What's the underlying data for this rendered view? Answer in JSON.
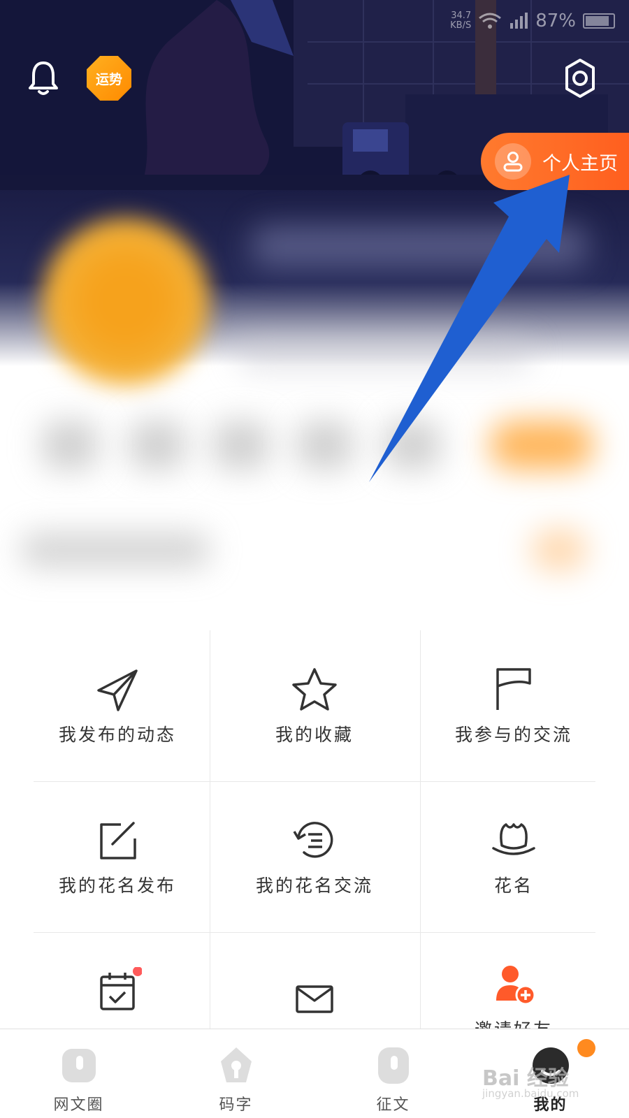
{
  "status_bar": {
    "net_speed_value": "34.7",
    "net_speed_unit": "KB/S",
    "battery_percent": "87%",
    "battery_level": 0.87
  },
  "header": {
    "fortune_badge": "运势",
    "homepage_button": "个人主页"
  },
  "menu": [
    {
      "label": "我发布的动态",
      "icon": "paper-plane-icon"
    },
    {
      "label": "我的收藏",
      "icon": "star-icon"
    },
    {
      "label": "我参与的交流",
      "icon": "flag-icon"
    },
    {
      "label": "我的花名发布",
      "icon": "edit-square-icon"
    },
    {
      "label": "我的花名交流",
      "icon": "chat-refresh-icon"
    },
    {
      "label": "花名",
      "icon": "lotus-icon"
    },
    {
      "label": "",
      "icon": "calendar-check-icon",
      "has_red_dot": true
    },
    {
      "label": "",
      "icon": "mail-icon"
    },
    {
      "label": "邀请好友",
      "icon": "invite-friend-icon"
    }
  ],
  "tabs": [
    {
      "label": "网文圈",
      "icon": "circle-tab-icon",
      "active": false
    },
    {
      "label": "码字",
      "icon": "pen-tab-icon",
      "active": false
    },
    {
      "label": "征文",
      "icon": "contest-tab-icon",
      "active": false
    },
    {
      "label": "我的",
      "icon": "profile-tab-icon",
      "active": true,
      "badge": true
    }
  ],
  "watermark": {
    "main": "Bai 经验",
    "sub": "jingyan.baidu.com"
  },
  "colors": {
    "accent_orange": "#ff6a26",
    "arrow_blue": "#1f5fd1",
    "header_dark": "#15173a"
  }
}
